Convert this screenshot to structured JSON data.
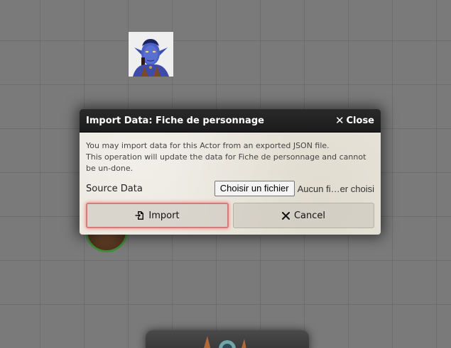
{
  "dialog": {
    "title": "Import Data: Fiche de personnage",
    "close_label": "Close",
    "message_line1": "You may import data for this Actor from an exported JSON file.",
    "message_line2": "This operation will update the data for Fiche de personnage and cannot be un-done.",
    "source_label": "Source Data",
    "file_button_label": "Choisir un fichier",
    "file_status": "Aucun fi…er choisi",
    "import_label": "Import",
    "cancel_label": "Cancel"
  },
  "icons": {
    "close": "close-icon",
    "import": "file-import-icon",
    "cancel": "x-icon"
  },
  "colors": {
    "header_bg": "#1f1f1f",
    "dialog_bg": "#e9e6dc",
    "canvas_bg": "#7a7a7a",
    "primary_glow": "#d27c7c"
  }
}
